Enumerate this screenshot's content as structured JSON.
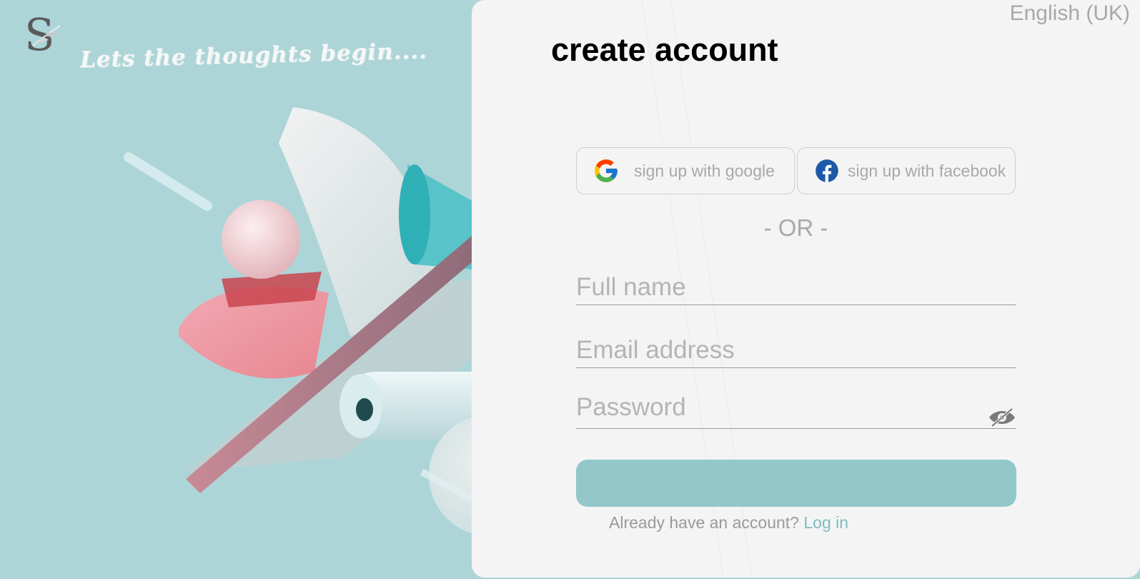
{
  "hero": {
    "logo_letter": "S",
    "tagline": "Lets the thoughts begin...."
  },
  "header": {
    "language": "English (UK)",
    "title": "create account"
  },
  "social": {
    "google_label": "sign up with google",
    "google_icon": "google-icon",
    "facebook_label": "sign up with facebook",
    "facebook_icon": "facebook-icon"
  },
  "divider": "- OR -",
  "form": {
    "full_name_placeholder": "Full name",
    "full_name_value": "",
    "email_placeholder": "Email address",
    "email_value": "",
    "password_placeholder": "Password",
    "password_value": "",
    "password_toggle_icon": "eye-off-icon",
    "submit_label": ""
  },
  "footer": {
    "prompt": "Already have an account?",
    "login_link": "Log in"
  },
  "colors": {
    "background": "#add5d8",
    "panel": "#f4f4f4",
    "accent": "#93c7ca",
    "link": "#7fbcc2",
    "muted_text": "#a8a8a8"
  }
}
